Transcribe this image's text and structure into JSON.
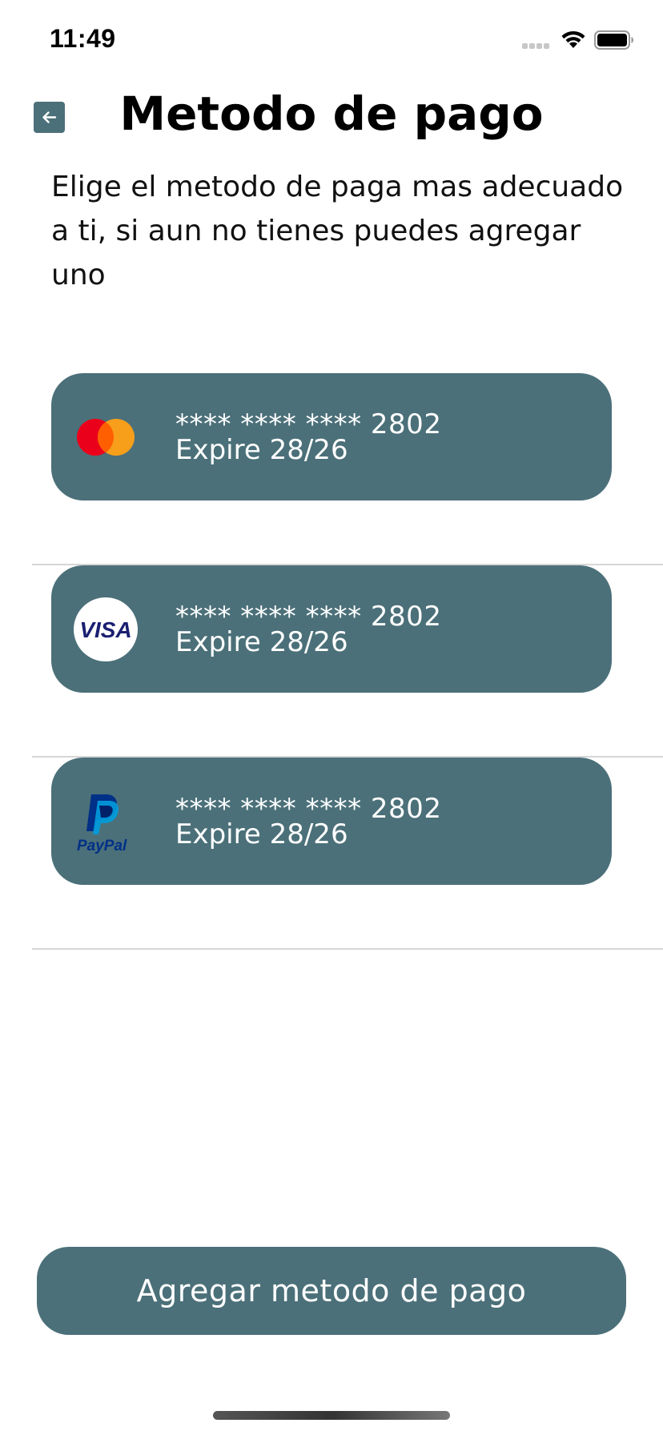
{
  "status_bar": {
    "time": "11:49",
    "icons": [
      "signal-icon",
      "wifi-icon",
      "battery-icon"
    ]
  },
  "header": {
    "back_icon": "arrow-left-icon",
    "title": "Metodo de pago"
  },
  "description": "Elige el metodo de paga mas adecuado a ti, si aun no tienes puedes agregar uno",
  "payment_methods": [
    {
      "brand_icon": "mastercard-icon",
      "masked_number": "**** **** **** 2802",
      "expiry": "Expire 28/26"
    },
    {
      "brand_icon": "visa-icon",
      "brand_text": "VISA",
      "masked_number": "**** **** **** 2802",
      "expiry": "Expire 28/26"
    },
    {
      "brand_icon": "paypal-icon",
      "brand_text": "PayPal",
      "masked_number": "**** **** **** 2802",
      "expiry": "Expire 28/26"
    }
  ],
  "add_button": {
    "label": "Agregar metodo de pago"
  },
  "colors": {
    "accent": "#4b7079",
    "card_text": "#ffffff",
    "divider": "#d6d6d6",
    "mastercard_red": "#eb001b",
    "mastercard_orange": "#f79e1b",
    "visa_blue": "#1a1f71",
    "paypal_dark_blue": "#003087",
    "paypal_light_blue": "#009cde"
  }
}
